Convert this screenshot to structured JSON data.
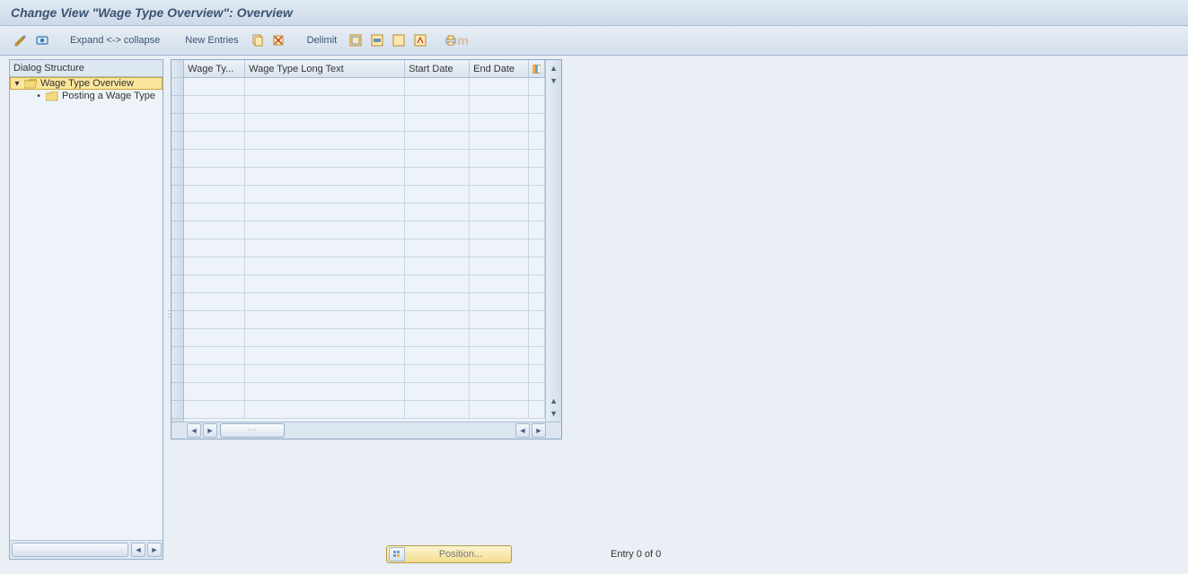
{
  "title": "Change View \"Wage Type Overview\": Overview",
  "toolbar": {
    "expand_collapse": "Expand <-> collapse",
    "new_entries": "New Entries",
    "delimit": "Delimit",
    "watermark": "m"
  },
  "tree": {
    "header": "Dialog Structure",
    "items": [
      {
        "label": "Wage Type Overview",
        "level": 0,
        "open": true,
        "active": true
      },
      {
        "label": "Posting a Wage Type",
        "level": 1,
        "open": false,
        "active": false
      }
    ]
  },
  "table": {
    "columns": {
      "c1": "Wage Ty...",
      "c2": "Wage Type Long Text",
      "c3": "Start Date",
      "c4": "End Date"
    },
    "row_count": 19
  },
  "footer": {
    "position_label": "Position...",
    "entry_text": "Entry 0 of 0"
  }
}
